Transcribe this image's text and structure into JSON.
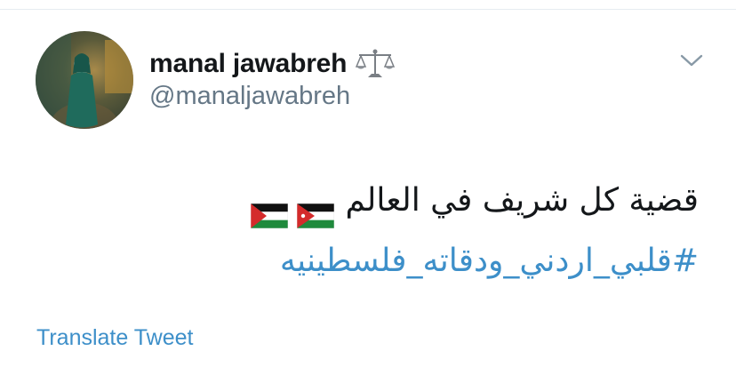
{
  "tweet": {
    "user": {
      "display_name": "manal jawabreh",
      "handle": "@manaljawabreh",
      "name_emoji": "scales-icon"
    },
    "text_line1": "قضية كل شريف في العالم",
    "flags": [
      "jordan-flag",
      "palestine-flag"
    ],
    "hashtag": "#قلبي_اردني_ودقاته_فلسطينيه",
    "translate_label": "Translate Tweet"
  },
  "colors": {
    "link": "#3d8fc9",
    "text": "#14171a",
    "secondary": "#657786"
  }
}
